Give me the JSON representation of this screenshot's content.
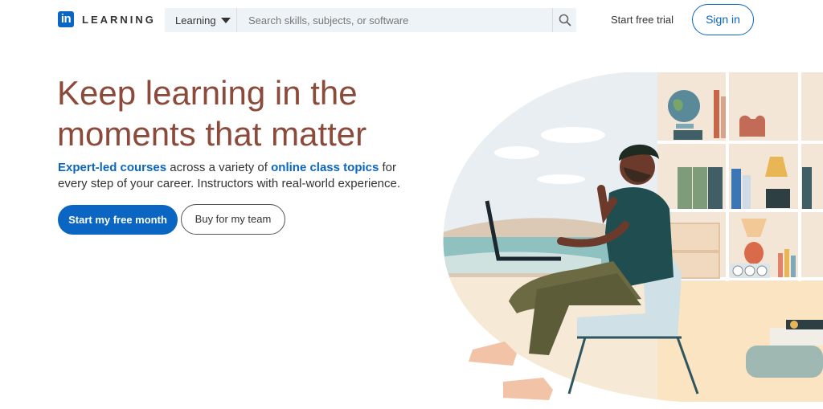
{
  "header": {
    "logo_mark": "in",
    "logo_text": "LEARNING",
    "search": {
      "category_label": "Learning",
      "placeholder": "Search skills, subjects, or software",
      "search_icon": "search-icon"
    },
    "start_trial_label": "Start free trial",
    "sign_in_label": "Sign in"
  },
  "hero": {
    "headline": "Keep learning in the moments that matter",
    "subtext": {
      "link1": "Expert-led courses",
      "part1": " across a variety of ",
      "link2": "online class topics",
      "part2": " for every step of your career. Instructors with real-world experience."
    },
    "primary_button": "Start my free month",
    "secondary_button": "Buy for my team"
  },
  "colors": {
    "brand": "#0a66c2",
    "headline": "#8b4a3a"
  }
}
